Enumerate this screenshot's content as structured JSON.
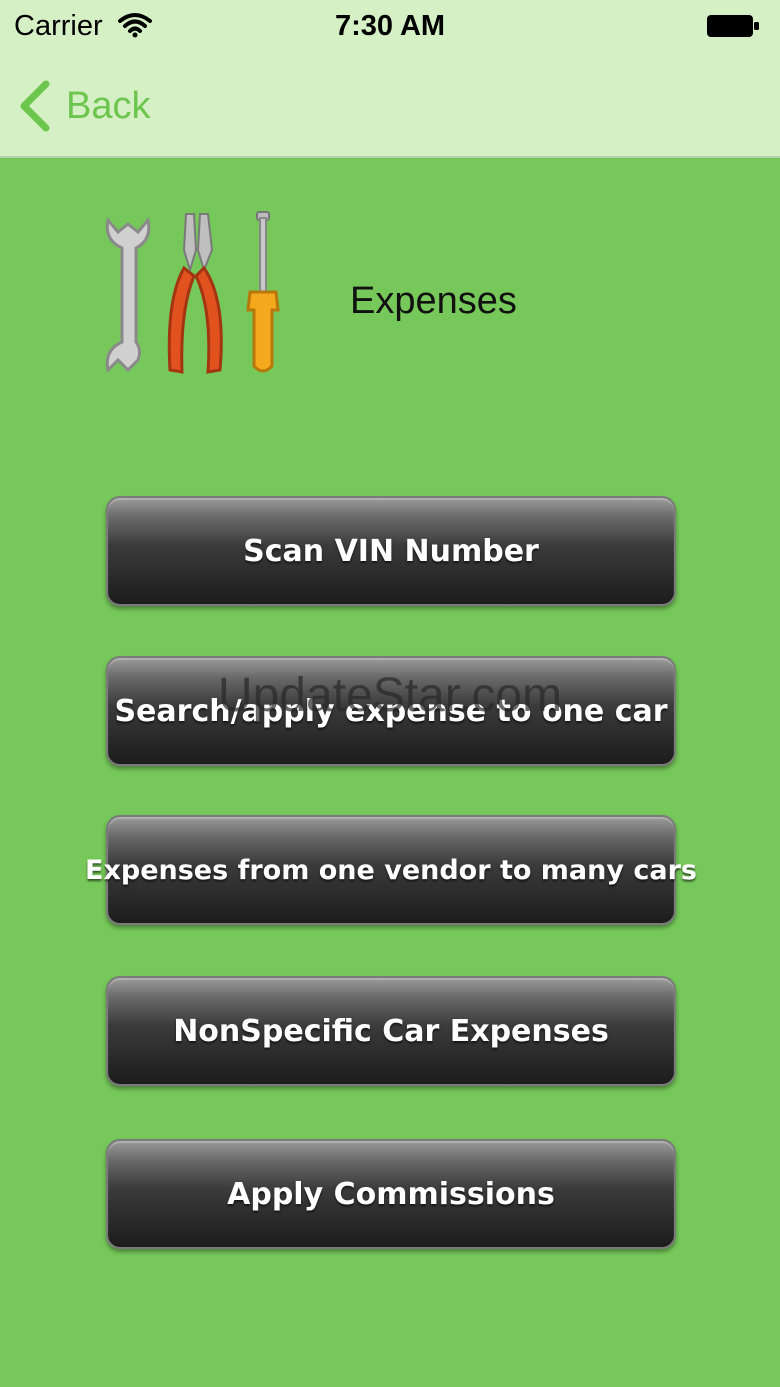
{
  "status_bar": {
    "carrier": "Carrier",
    "time": "7:30 AM"
  },
  "nav": {
    "back_label": "Back"
  },
  "header": {
    "title": "Expenses",
    "icon": "tools-icon"
  },
  "buttons": [
    {
      "label": "Scan VIN Number"
    },
    {
      "label": "Search/apply expense to one car"
    },
    {
      "label": "Expenses from one vendor to many cars"
    },
    {
      "label": "NonSpecific Car Expenses"
    },
    {
      "label": "Apply Commissions"
    }
  ],
  "watermark": "UpdateStar.com",
  "colors": {
    "background": "#76c85a",
    "nav_background": "#d5f0c4",
    "accent": "#6cc54d"
  }
}
